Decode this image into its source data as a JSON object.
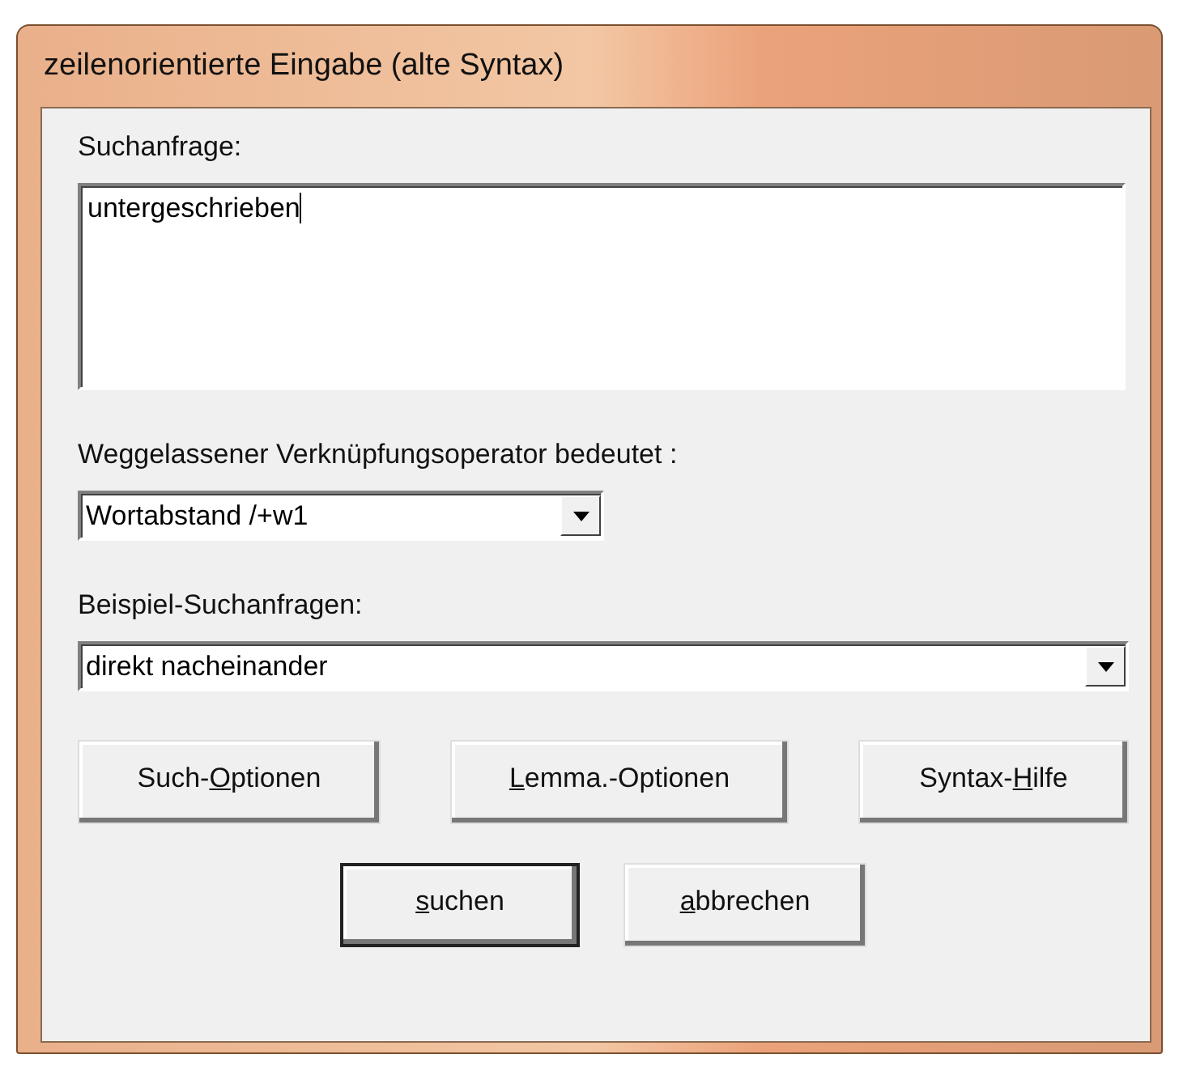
{
  "window": {
    "title": "zeilenorientierte Eingabe (alte Syntax)"
  },
  "query": {
    "label": "Suchanfrage:",
    "value": "untergeschrieben"
  },
  "operator": {
    "label": "Weggelassener Verknüpfungsoperator bedeutet :",
    "value": "Wortabstand /+w1"
  },
  "examples": {
    "label": "Beispiel-Suchanfragen:",
    "value": "direkt nacheinander"
  },
  "option_buttons": [
    {
      "pre": "Such-",
      "key": "O",
      "post": "ptionen",
      "default": false
    },
    {
      "key": "L",
      "post": "emma.-Optionen",
      "default": false
    },
    {
      "pre": "Syntax-",
      "key": "H",
      "post": "ilfe",
      "default": false
    }
  ],
  "action_buttons": [
    {
      "key": "s",
      "post": "uchen",
      "default": true
    },
    {
      "key": "a",
      "post": "bbrechen",
      "default": false
    }
  ]
}
